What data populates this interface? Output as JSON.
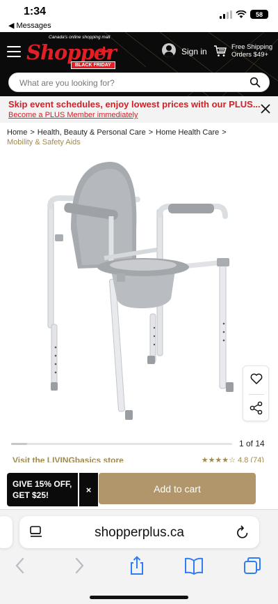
{
  "status_bar": {
    "time": "1:34",
    "back_label": "◀ Messages",
    "battery": "58"
  },
  "header": {
    "logo_tagline": "Canada's online shopping mall",
    "logo_wordmark": "Shopper",
    "logo_plus": "+",
    "logo_badge": "BLACK FRIDAY",
    "sign_in": "Sign in",
    "shipping_line1": "Free Shipping",
    "shipping_line2": "Orders $49+",
    "search_placeholder": "What are you looking for?"
  },
  "promo": {
    "title": "Skip event schedules, enjoy lowest prices with our PLUS...",
    "link": "Become a PLUS Member immediately"
  },
  "breadcrumb": {
    "items": [
      "Home",
      "Health, Beauty & Personal Care",
      "Home Health Care",
      "Mobility & Safety Aids"
    ],
    "separator": ">"
  },
  "gallery": {
    "counter": "1 of 14",
    "progress": 0.071
  },
  "store": {
    "link": "Visit the LIVINGbasics store",
    "rating_text": "4.8 (74)"
  },
  "sticky": {
    "offer_line1": "GIVE 15% OFF,",
    "offer_line2": "GET $25!",
    "offer_close": "×",
    "add_to_cart": "Add to cart"
  },
  "safari": {
    "url": "shopperplus.ca"
  },
  "colors": {
    "header_bg": "#0b0b0b",
    "brand_red": "#e31e24",
    "promo_red": "#d22027",
    "gold": "#b0966a",
    "ios_blue": "#2f7cf6"
  }
}
